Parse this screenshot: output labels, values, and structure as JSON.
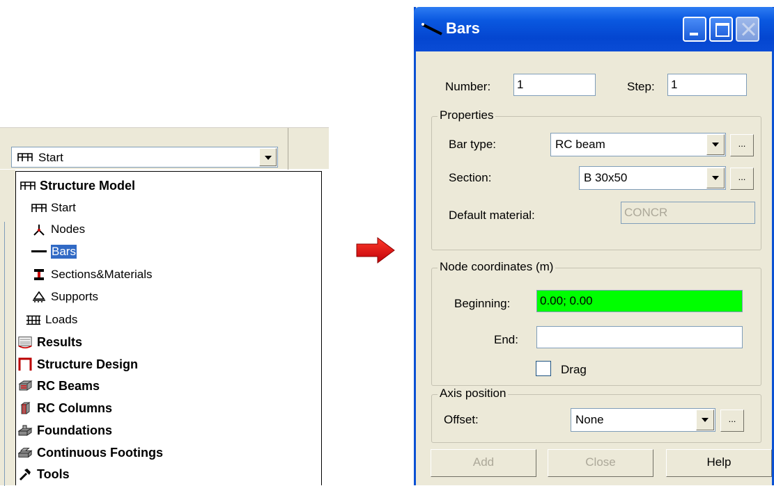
{
  "layout_combo": {
    "selected": "Start"
  },
  "layout_list": {
    "items": [
      {
        "label": "Structure Model",
        "icon": "structure-model-icon",
        "bold": true,
        "level": 0
      },
      {
        "label": "Start",
        "icon": "start-icon",
        "bold": false,
        "level": 1
      },
      {
        "label": "Nodes",
        "icon": "nodes-icon",
        "bold": false,
        "level": 1
      },
      {
        "label": "Bars",
        "icon": "bars-icon",
        "bold": false,
        "level": 1,
        "selected": true
      },
      {
        "label": "Sections&Materials",
        "icon": "sections-materials-icon",
        "bold": false,
        "level": 1
      },
      {
        "label": "Supports",
        "icon": "supports-icon",
        "bold": false,
        "level": 1
      },
      {
        "label": "Loads",
        "icon": "loads-icon",
        "bold": false,
        "level": 1
      },
      {
        "label": "Results",
        "icon": "results-icon",
        "bold": true,
        "level": 0
      },
      {
        "label": "Structure Design",
        "icon": "structure-design-icon",
        "bold": true,
        "level": 0
      },
      {
        "label": "RC Beams",
        "icon": "rc-beams-icon",
        "bold": true,
        "level": 0
      },
      {
        "label": "RC Columns",
        "icon": "rc-columns-icon",
        "bold": true,
        "level": 0
      },
      {
        "label": "Foundations",
        "icon": "foundations-icon",
        "bold": true,
        "level": 0
      },
      {
        "label": "Continuous Footings",
        "icon": "continuous-footings-icon",
        "bold": true,
        "level": 0
      },
      {
        "label": "Tools",
        "icon": "tools-icon",
        "bold": true,
        "level": 0
      }
    ]
  },
  "arrow": {
    "icon": "right-arrow-icon",
    "color": "#e8000b"
  },
  "dialog": {
    "title": "Bars",
    "number_label": "Number:",
    "number_value": "1",
    "step_label": "Step:",
    "step_value": "1",
    "properties": {
      "title": "Properties",
      "bar_type_label": "Bar type:",
      "bar_type_value": "RC beam",
      "section_label": "Section:",
      "section_value": "B 30x50",
      "material_label": "Default material:",
      "material_value": "CONCR",
      "more_label": "..."
    },
    "node_coordinates": {
      "title": "Node coordinates (m)",
      "beginning_label": "Beginning:",
      "beginning_value": "0.00; 0.00",
      "end_label": "End:",
      "end_value": "",
      "drag_label": "Drag",
      "drag_checked": false,
      "highlight_color": "#00ff00"
    },
    "axis_position": {
      "title": "Axis position",
      "offset_label": "Offset:",
      "offset_value": "None"
    },
    "buttons": {
      "add": "Add",
      "close": "Close",
      "help": "Help"
    }
  }
}
